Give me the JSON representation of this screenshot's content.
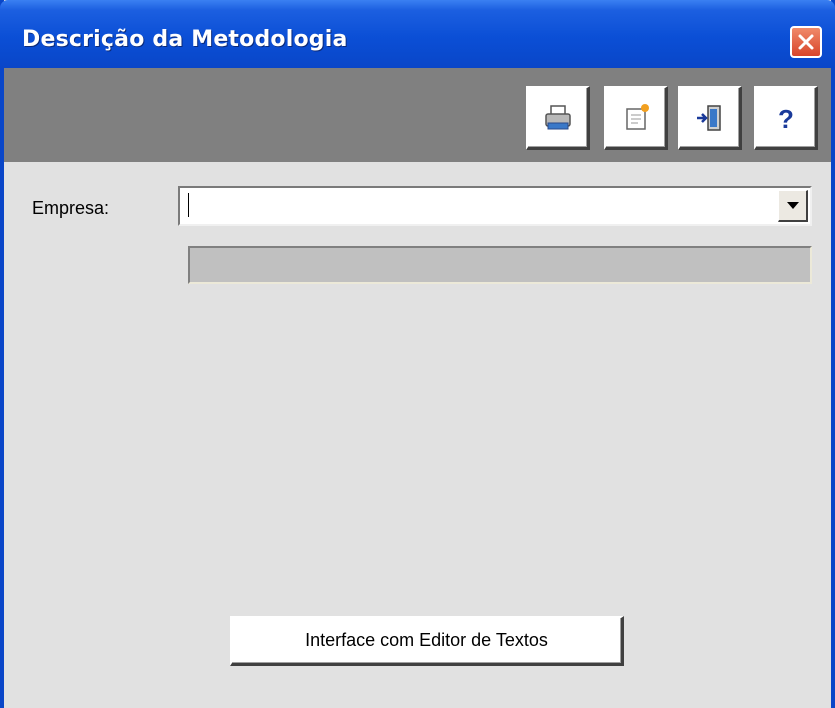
{
  "window": {
    "title": "Descrição da Metodologia",
    "title_bar_color": "#0a46c8",
    "close_icon": "close-icon"
  },
  "toolbar": {
    "buttons": [
      {
        "icon": "printer-icon"
      },
      {
        "icon": "edit-document-icon"
      },
      {
        "icon": "exit-door-icon"
      },
      {
        "icon": "help-icon"
      }
    ]
  },
  "form": {
    "empresa_label": "Empresa:",
    "empresa_value": "",
    "empresa_description": ""
  },
  "actions": {
    "editor_button_label": "Interface com Editor de Textos"
  }
}
